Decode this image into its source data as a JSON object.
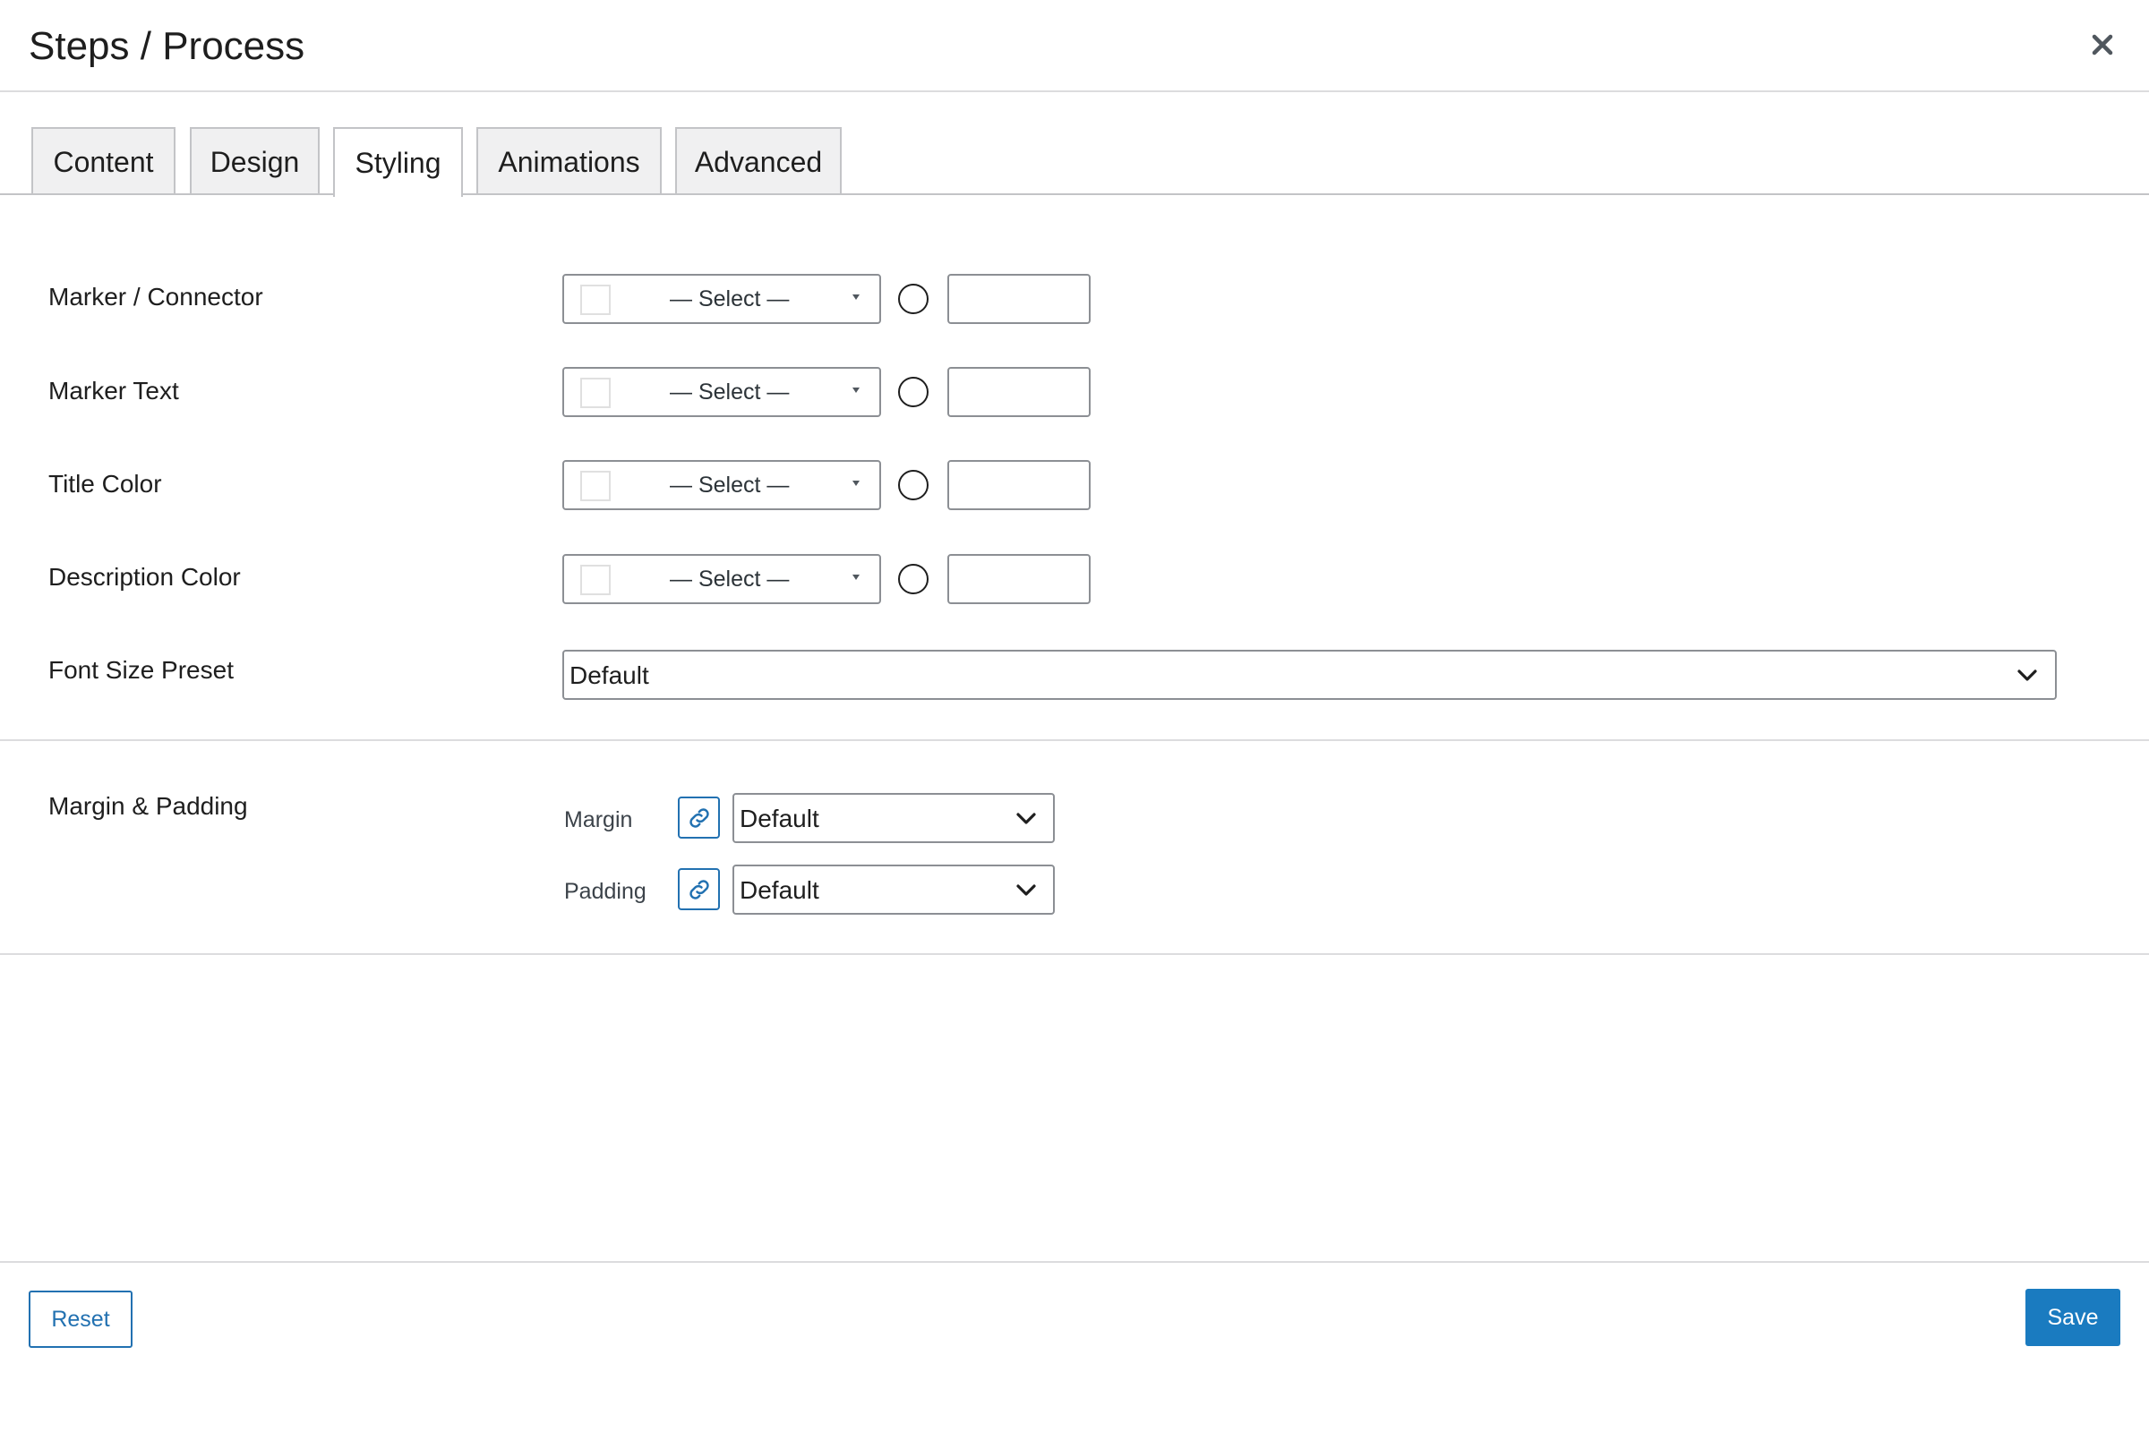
{
  "modal": {
    "title": "Steps / Process",
    "close_icon": "close-icon"
  },
  "tabs": [
    {
      "label": "Content",
      "active": false
    },
    {
      "label": "Design",
      "active": false
    },
    {
      "label": "Styling",
      "active": true
    },
    {
      "label": "Animations",
      "active": false
    },
    {
      "label": "Advanced",
      "active": false
    }
  ],
  "styling": {
    "color_fields": [
      {
        "label": "Marker / Connector",
        "select_value": "— Select —",
        "opacity_value": ""
      },
      {
        "label": "Marker Text",
        "select_value": "— Select —",
        "opacity_value": ""
      },
      {
        "label": "Title Color",
        "select_value": "— Select —",
        "opacity_value": ""
      },
      {
        "label": "Description Color",
        "select_value": "— Select —",
        "opacity_value": ""
      }
    ],
    "font_size_preset": {
      "label": "Font Size Preset",
      "value": "Default"
    }
  },
  "spacing": {
    "section_label": "Margin & Padding",
    "margin": {
      "label": "Margin",
      "value": "Default",
      "link_icon": "link-icon"
    },
    "padding": {
      "label": "Padding",
      "value": "Default",
      "link_icon": "link-icon"
    }
  },
  "footer": {
    "reset_label": "Reset",
    "save_label": "Save"
  },
  "colors": {
    "accent": "#2271b1",
    "save_button": "#1a7bc0",
    "border": "#8c8f94"
  }
}
